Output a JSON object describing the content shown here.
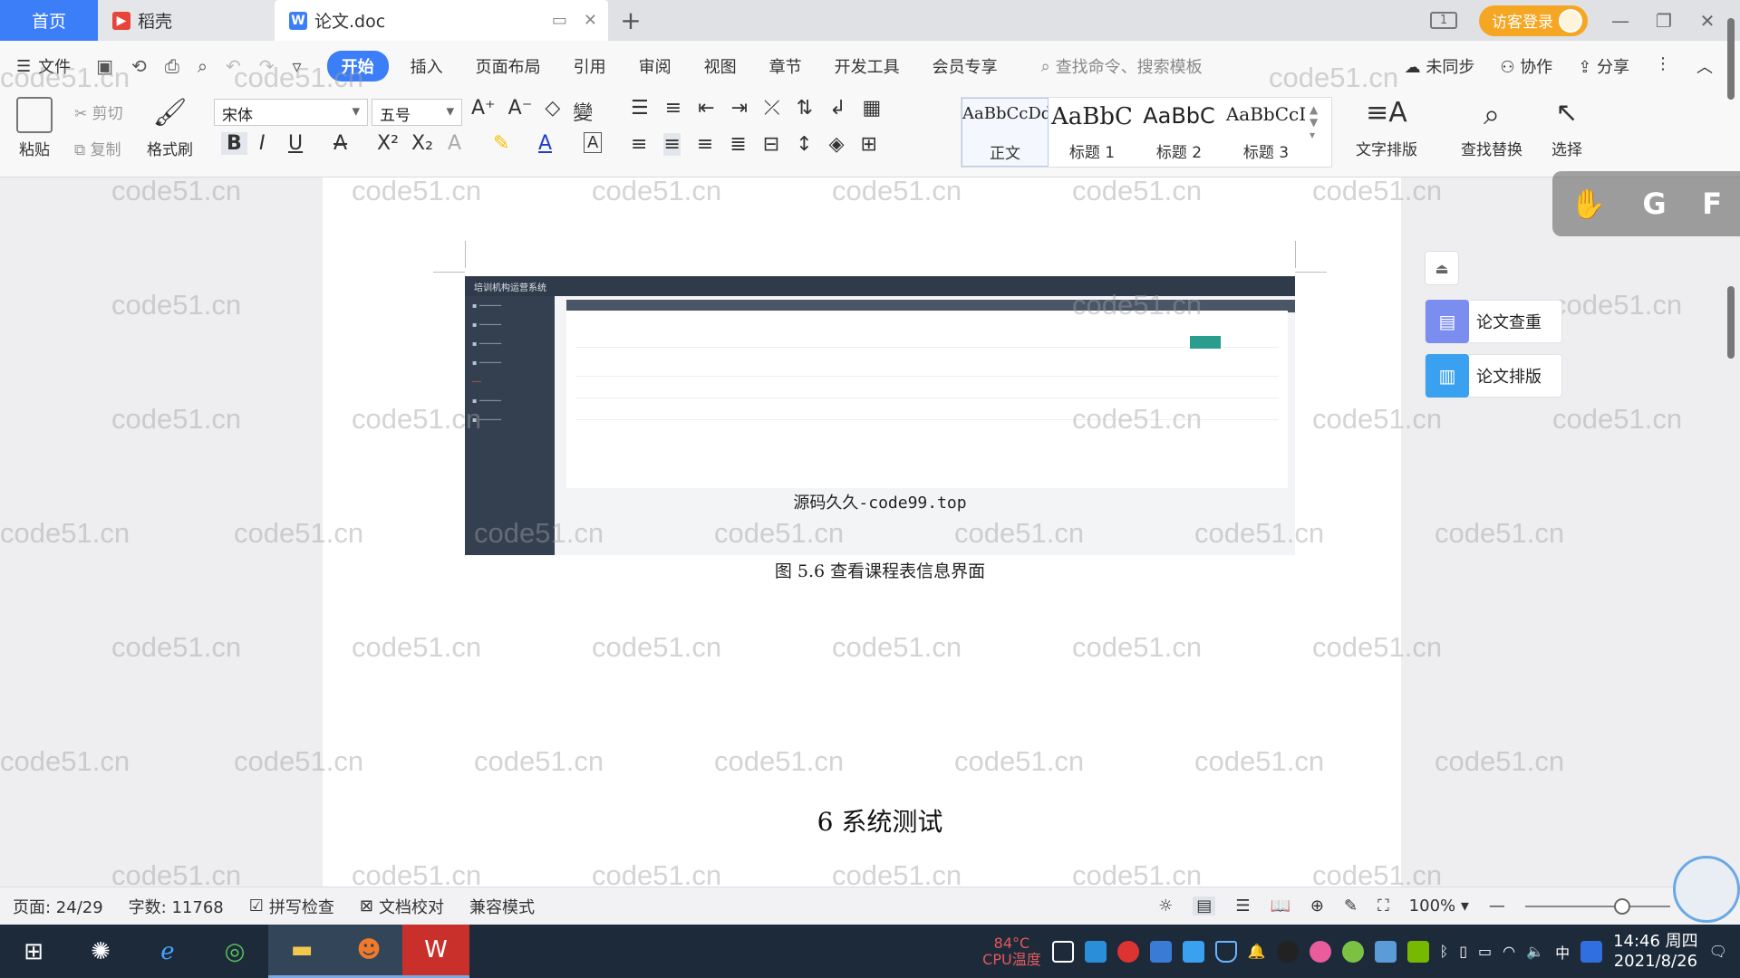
{
  "tabs": {
    "home": "首页",
    "docer": "稻壳",
    "doc": "论文.doc",
    "new_tab": "+"
  },
  "titlebar": {
    "login": "访客登录",
    "page_indicator": "1"
  },
  "menu": {
    "file": "文件",
    "items": [
      "开始",
      "插入",
      "页面布局",
      "引用",
      "审阅",
      "视图",
      "章节",
      "开发工具",
      "会员专享"
    ],
    "search_placeholder": "查找命令、搜索模板",
    "sync": "未同步",
    "collab": "协作",
    "share": "分享"
  },
  "ribbon": {
    "paste": "粘贴",
    "cut": "剪切",
    "copy": "复制",
    "format_painter": "格式刷",
    "font": "宋体",
    "size": "五号",
    "styles": [
      {
        "sample": "AaBbCcDd",
        "label": "正文"
      },
      {
        "sample": "AaBbC",
        "label": "标题 1"
      },
      {
        "sample": "AaBbC",
        "label": "标题 2"
      },
      {
        "sample": "AaBbCcI",
        "label": "标题 3"
      }
    ],
    "text_layout": "文字排版",
    "find_replace": "查找替换",
    "select": "选择"
  },
  "figure": {
    "app_title": "培训机构运营系统",
    "watermark_text": "源码久久-code99.top",
    "caption": "图 5.6  查看课程表信息界面"
  },
  "document": {
    "heading": "6 系统测试",
    "watermark": "code51.cn"
  },
  "side_panel": {
    "check": "论文查重",
    "layout": "论文排版"
  },
  "status": {
    "page": "页面: 24/29",
    "words": "字数: 11768",
    "spell": "拼写检查",
    "proof": "文档校对",
    "compat": "兼容模式",
    "zoom": "100%"
  },
  "taskbar": {
    "cpu_temp": "84°C",
    "cpu_label": "CPU温度",
    "time": "14:46 周四",
    "date": "2021/8/26",
    "ime": "中"
  },
  "colors": {
    "accent": "#3c7ef7",
    "login": "#f5a623",
    "taskbar": "#1c2a3a"
  }
}
